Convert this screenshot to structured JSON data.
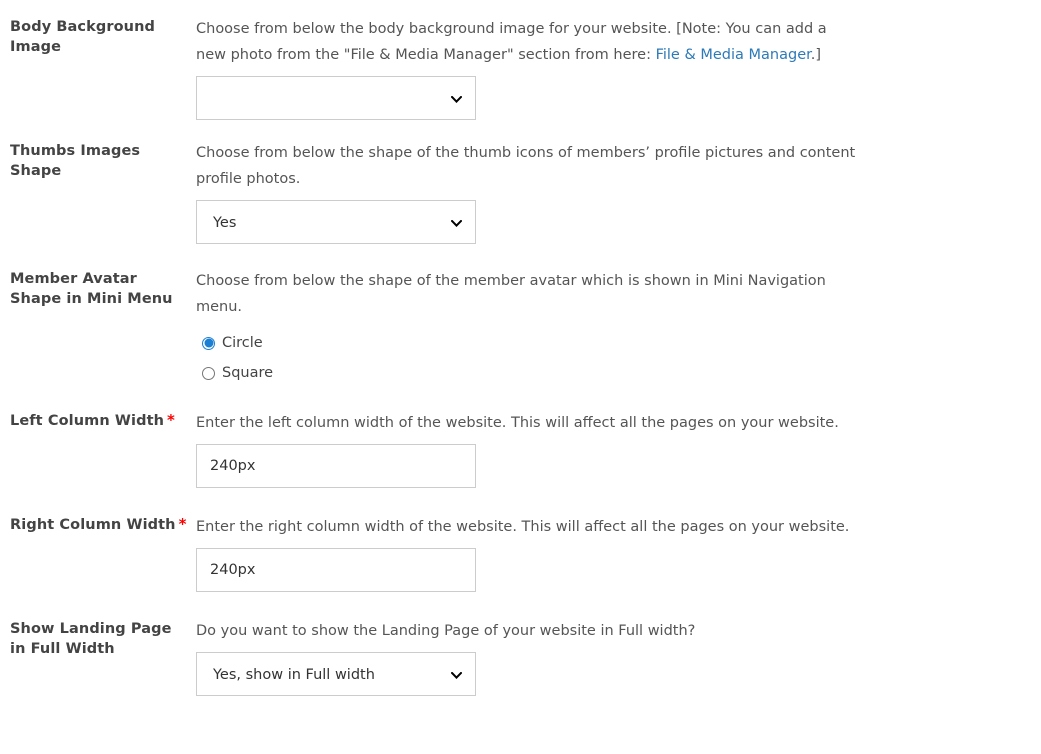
{
  "form": {
    "rows": [
      {
        "label": "Body Background Image",
        "required": false,
        "description_before_link": "Choose from below the body background image for your website. [Note: You can add a new photo from the \"File & Media Manager\" section from here: ",
        "link_text": "File & Media Manager",
        "description_after_link": ".]",
        "control": "select",
        "value": "",
        "icon": "chevron-down-icon"
      },
      {
        "label": "Thumbs Images Shape",
        "required": false,
        "description": "Choose from below the shape of the thumb icons of members’ profile pictures and content profile photos.",
        "control": "select",
        "value": "Yes",
        "icon": "chevron-down-icon"
      },
      {
        "label": "Member Avatar Shape in Mini Menu",
        "required": false,
        "description": "Choose from below the shape of the member avatar which is shown in Mini Navigation menu.",
        "control": "radio",
        "options": [
          {
            "label": "Circle",
            "selected": true
          },
          {
            "label": "Square",
            "selected": false
          }
        ]
      },
      {
        "label": "Left Column Width",
        "required": true,
        "description": "Enter the left column width of the website. This will affect all the pages on your website.",
        "control": "text",
        "value": "240px"
      },
      {
        "label": "Right Column Width",
        "required": true,
        "description": "Enter the right column width of the website. This will affect all the pages on your website.",
        "control": "text",
        "value": "240px"
      },
      {
        "label": "Show Landing Page in Full Width",
        "required": false,
        "description": "Do you want to show the Landing Page of your website in Full width?",
        "control": "select",
        "value": "Yes, show in Full width",
        "icon": "chevron-down-icon"
      }
    ],
    "required_marker": "*",
    "colors": {
      "label": "#444444",
      "description": "#555555",
      "link": "#2d7ab8",
      "required": "#ff0000",
      "border": "#cccccc",
      "radio_accent": "#1b7fd4",
      "background": "#ffffff"
    }
  }
}
